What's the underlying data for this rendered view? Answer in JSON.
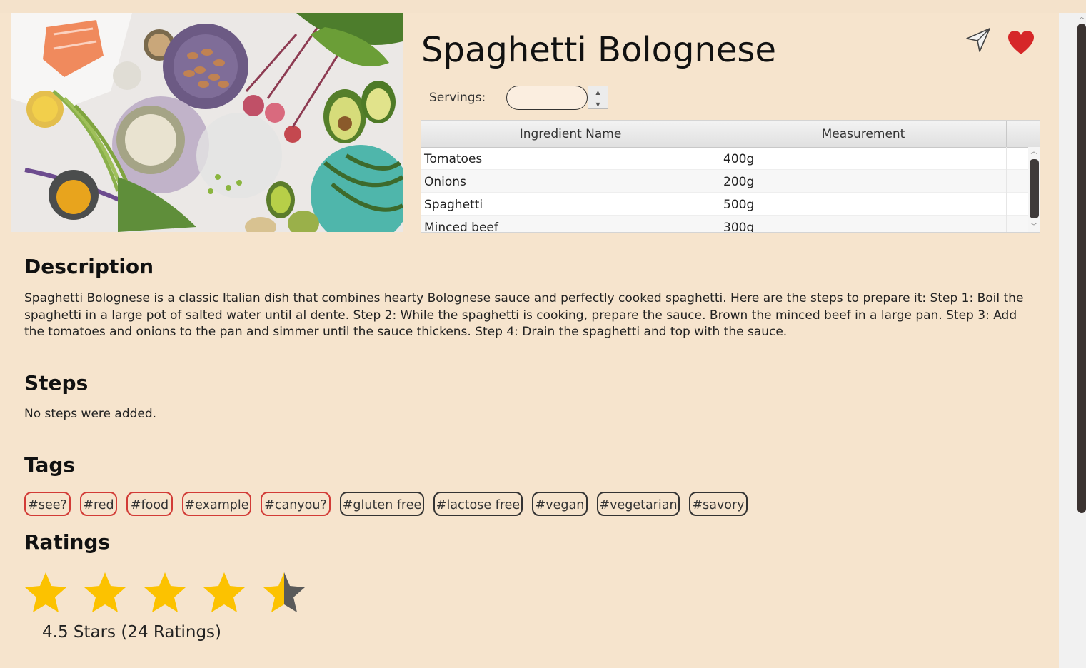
{
  "recipe": {
    "title": "Spaghetti Bolognese",
    "servings_label": "Servings:",
    "servings_value": ""
  },
  "actions": {
    "send_icon": "paper-plane-icon",
    "favorite_icon": "heart-icon",
    "favorite_color": "#d62728"
  },
  "ingredients": {
    "columns": [
      "Ingredient Name",
      "Measurement"
    ],
    "rows": [
      [
        "Tomatoes",
        "400g"
      ],
      [
        "Onions",
        "200g"
      ],
      [
        "Spaghetti",
        "500g"
      ],
      [
        "Minced beef",
        "300g"
      ]
    ]
  },
  "description": {
    "heading": "Description",
    "text": "Spaghetti Bolognese is a classic Italian dish that combines hearty Bolognese sauce and perfectly cooked spaghetti. Here are the steps to prepare it: Step 1: Boil the spaghetti in a large pot of salted water until al dente. Step 2: While the spaghetti is cooking, prepare the sauce. Brown the minced beef in a large pan. Step 3: Add the tomatoes and onions to the pan and simmer until the sauce thickens. Step 4: Drain the spaghetti and top with the sauce."
  },
  "steps": {
    "heading": "Steps",
    "empty_text": "No steps were added."
  },
  "tags": {
    "heading": "Tags",
    "items": [
      {
        "label": "#see?",
        "style": "red"
      },
      {
        "label": "#red",
        "style": "red"
      },
      {
        "label": "#food",
        "style": "red"
      },
      {
        "label": "#example",
        "style": "red"
      },
      {
        "label": "#canyou?",
        "style": "red"
      },
      {
        "label": "#gluten free",
        "style": "dark"
      },
      {
        "label": "#lactose free",
        "style": "dark"
      },
      {
        "label": "#vegan",
        "style": "dark"
      },
      {
        "label": "#vegetarian",
        "style": "dark"
      },
      {
        "label": "#savory",
        "style": "dark"
      }
    ]
  },
  "ratings": {
    "heading": "Ratings",
    "stars_value": 4.5,
    "stars_max": 5,
    "star_color": "#fcc200",
    "star_empty_color": "#5a5a5a",
    "summary": "4.5 Stars (24 Ratings)"
  }
}
